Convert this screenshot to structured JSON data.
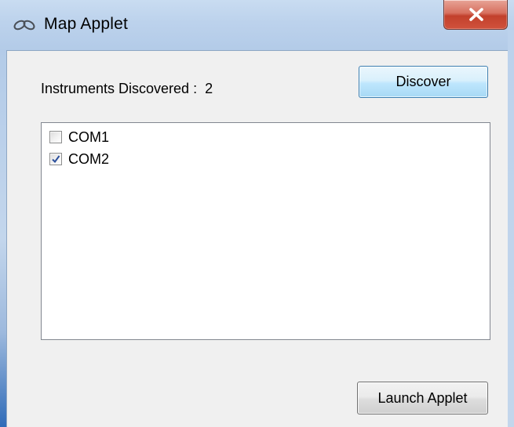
{
  "window": {
    "title": "Map Applet",
    "icon": "link-chain-icon",
    "close_symbol": "X"
  },
  "instruments": {
    "label": "Instruments Discovered :",
    "count": "2"
  },
  "buttons": {
    "discover_label": "Discover",
    "launch_label": "Launch Applet"
  },
  "list": {
    "items": [
      {
        "label": "COM1",
        "checked": false
      },
      {
        "label": "COM2",
        "checked": true
      }
    ]
  },
  "colors": {
    "titlebar": "#bcd2ec",
    "close_button": "#c2402c",
    "discover_button": "#bee6fd",
    "checkmark": "#2a4e9b",
    "client_background": "#f0f0f0"
  }
}
